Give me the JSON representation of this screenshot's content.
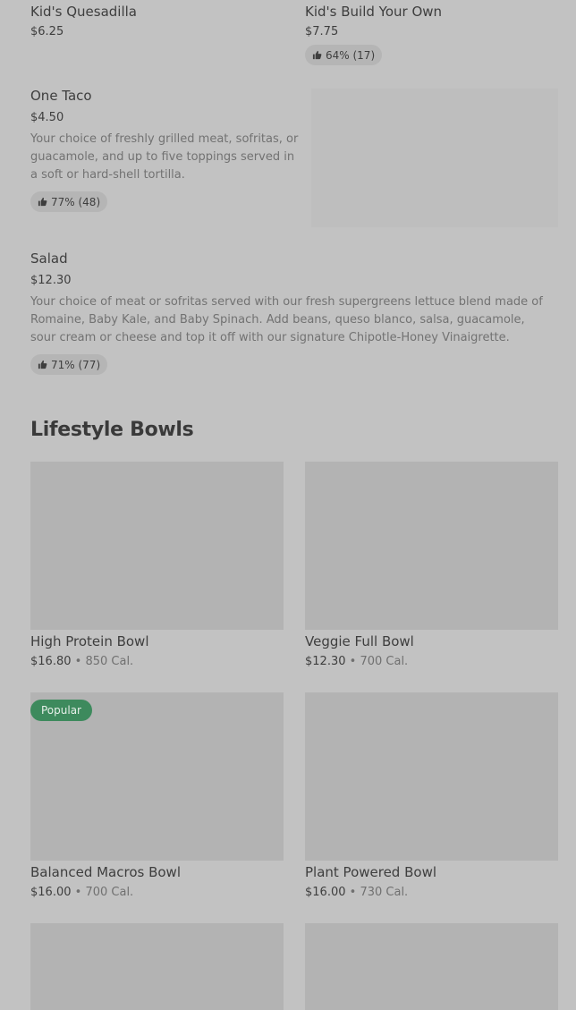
{
  "items": [
    {
      "name": "Kid's Quesadilla",
      "price": "$6.25"
    },
    {
      "name": "Kid's Build Your Own",
      "price": "$7.75",
      "rating": "64% (17)"
    },
    {
      "name": "One Taco",
      "price": "$4.50",
      "description": "Your choice of freshly grilled meat, sofritas, or guacamole, and up to five toppings served in a soft or hard-shell tortilla.",
      "rating": "77% (48)"
    },
    {
      "name": "Salad",
      "price": "$12.30",
      "description": "Your choice of meat or sofritas served with our fresh supergreens lettuce blend made of Romaine, Baby Kale, and Baby Spinach. Add beans, queso blanco, salsa, guacamole, sour cream or cheese and top it off with our signature Chipotle-Honey Vinaigrette.",
      "rating": "71% (77)"
    }
  ],
  "lifestyle": {
    "title": "Lifestyle Bowls",
    "separator": "•",
    "bowls": [
      {
        "name": "High Protein Bowl",
        "price": "$16.80",
        "calories": "850 Cal."
      },
      {
        "name": "Veggie Full Bowl",
        "price": "$12.30",
        "calories": "700 Cal."
      },
      {
        "name": "Balanced Macros Bowl",
        "price": "$16.00",
        "calories": "700 Cal.",
        "badge": "Popular"
      },
      {
        "name": "Plant Powered Bowl",
        "price": "$16.00",
        "calories": "730 Cal."
      }
    ]
  },
  "icons": {
    "rating": "thumbs-up-icon"
  },
  "colors": {
    "background": "#c2c2c2",
    "placeholder": "#b3b3b3",
    "badge": "#3d8a5d",
    "pill": "#b5b5b5"
  }
}
